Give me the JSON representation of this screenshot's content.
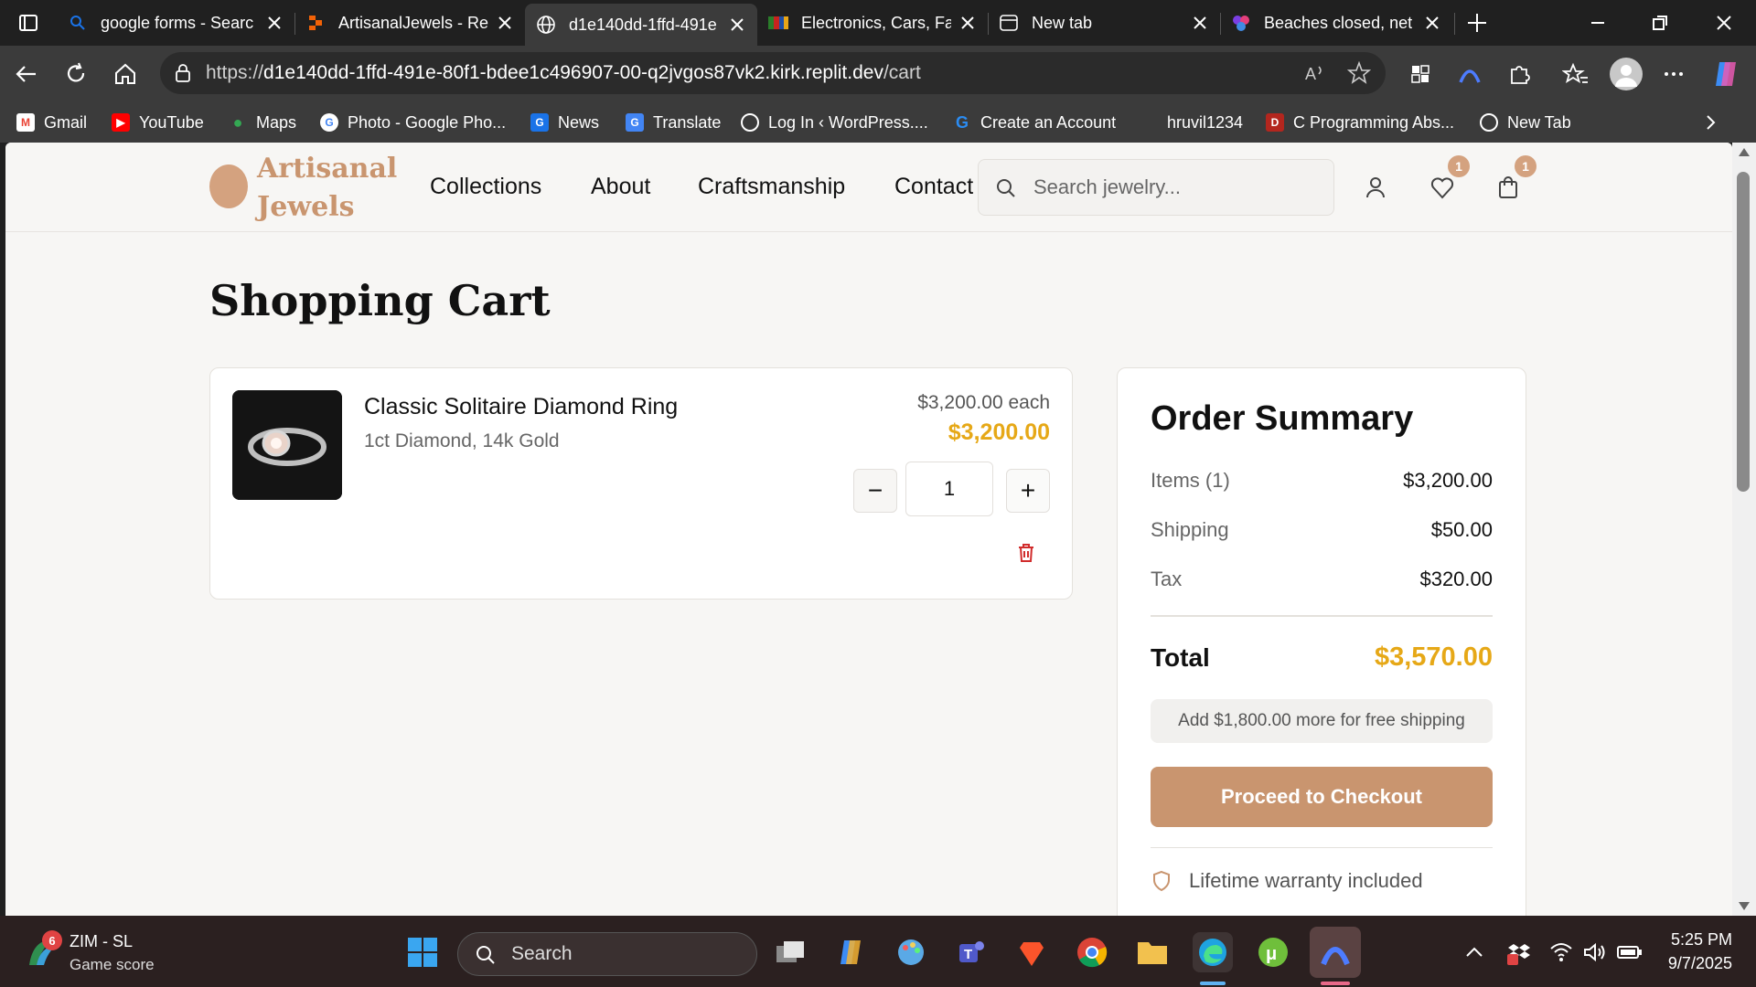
{
  "browser": {
    "tabs": [
      {
        "title": "google forms - Searc",
        "icon": "search-favicon",
        "active": false
      },
      {
        "title": "ArtisanalJewels - Rep",
        "icon": "replit-favicon",
        "active": false
      },
      {
        "title": "d1e140dd-1ffd-491e",
        "icon": "globe-favicon",
        "active": true
      },
      {
        "title": "Electronics, Cars, Fas",
        "icon": "store-favicon",
        "active": false
      },
      {
        "title": "New tab",
        "icon": "newtab-favicon",
        "active": false
      },
      {
        "title": "Beaches closed, net",
        "icon": "news-favicon",
        "active": false
      }
    ],
    "url_prefix": "https://",
    "url_host": "d1e140dd-1ffd-491e-80f1-bdee1c496907-00-q2jvgos87vk2.kirk.replit.dev",
    "url_path": "/cart",
    "bookmarks": [
      {
        "label": "Gmail",
        "icon": "gmail-icon",
        "color": "#ea4335"
      },
      {
        "label": "YouTube",
        "icon": "youtube-icon",
        "color": "#ff0000"
      },
      {
        "label": "Maps",
        "icon": "maps-icon",
        "color": "#34a853"
      },
      {
        "label": "Photo - Google Pho...",
        "icon": "google-icon",
        "color": "#4285f4"
      },
      {
        "label": "News",
        "icon": "news-icon",
        "color": "#1a73e8"
      },
      {
        "label": "Translate",
        "icon": "translate-icon",
        "color": "#4285f4"
      },
      {
        "label": "Log In ‹ WordPress....",
        "icon": "globe-icon",
        "color": "#888888"
      },
      {
        "label": "Create an Account",
        "icon": "account-icon",
        "color": "#2b8cf2"
      },
      {
        "label": "hruvil1234",
        "icon": "none",
        "color": "#3b3b3b"
      },
      {
        "label": "C Programming Abs...",
        "icon": "pdf-icon",
        "color": "#b3261e"
      },
      {
        "label": "New Tab",
        "icon": "globe-icon",
        "color": "#888888"
      }
    ]
  },
  "site": {
    "brand_line1": "Artisanal",
    "brand_line2": "Jewels",
    "nav": [
      "Collections",
      "About",
      "Craftsmanship",
      "Contact"
    ],
    "search_placeholder": "Search jewelry...",
    "wishlist_count": "1",
    "cart_count": "1",
    "accent_color": "#c9956f",
    "price_color": "#e6a817"
  },
  "cart": {
    "title": "Shopping Cart",
    "items": [
      {
        "name": "Classic Solitaire Diamond Ring",
        "description": "1ct Diamond, 14k Gold",
        "unit_price": "$3,200.00 each",
        "line_total": "$3,200.00",
        "quantity": "1",
        "decrement": "−",
        "increment": "+"
      }
    ]
  },
  "summary": {
    "title": "Order Summary",
    "items_label": "Items (1)",
    "items_value": "$3,200.00",
    "shipping_label": "Shipping",
    "shipping_value": "$50.00",
    "tax_label": "Tax",
    "tax_value": "$320.00",
    "total_label": "Total",
    "total_value": "$3,570.00",
    "free_shipping_note": "Add $1,800.00 more for free shipping",
    "checkout_label": "Proceed to Checkout",
    "warranty": "Lifetime warranty included"
  },
  "taskbar": {
    "weather_title": "ZIM - SL",
    "weather_sub": "Game score",
    "weather_badge": "6",
    "search_label": "Search",
    "time": "5:25 PM",
    "date": "9/7/2025"
  }
}
